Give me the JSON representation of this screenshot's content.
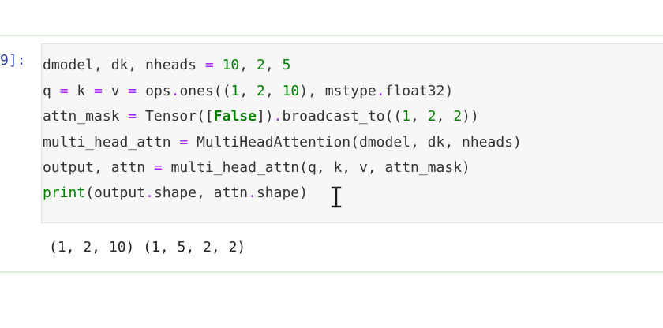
{
  "cell": {
    "prompt": "9]:",
    "code": [
      [
        {
          "t": "dmodel, dk, nheads ",
          "c": "name"
        },
        {
          "t": "=",
          "c": "op"
        },
        {
          "t": " ",
          "c": "name"
        },
        {
          "t": "10",
          "c": "num"
        },
        {
          "t": ", ",
          "c": "name"
        },
        {
          "t": "2",
          "c": "num"
        },
        {
          "t": ", ",
          "c": "name"
        },
        {
          "t": "5",
          "c": "num"
        }
      ],
      [
        {
          "t": "q ",
          "c": "name"
        },
        {
          "t": "=",
          "c": "op"
        },
        {
          "t": " k ",
          "c": "name"
        },
        {
          "t": "=",
          "c": "op"
        },
        {
          "t": " v ",
          "c": "name"
        },
        {
          "t": "=",
          "c": "op"
        },
        {
          "t": " ops",
          "c": "name"
        },
        {
          "t": ".",
          "c": "op"
        },
        {
          "t": "ones((",
          "c": "name"
        },
        {
          "t": "1",
          "c": "num"
        },
        {
          "t": ", ",
          "c": "name"
        },
        {
          "t": "2",
          "c": "num"
        },
        {
          "t": ", ",
          "c": "name"
        },
        {
          "t": "10",
          "c": "num"
        },
        {
          "t": "), mstype",
          "c": "name"
        },
        {
          "t": ".",
          "c": "op"
        },
        {
          "t": "float32)",
          "c": "name"
        }
      ],
      [
        {
          "t": "attn_mask ",
          "c": "name"
        },
        {
          "t": "=",
          "c": "op"
        },
        {
          "t": " Tensor([",
          "c": "name"
        },
        {
          "t": "False",
          "c": "kw"
        },
        {
          "t": "])",
          "c": "name"
        },
        {
          "t": ".",
          "c": "op"
        },
        {
          "t": "broadcast_to((",
          "c": "name"
        },
        {
          "t": "1",
          "c": "num"
        },
        {
          "t": ", ",
          "c": "name"
        },
        {
          "t": "2",
          "c": "num"
        },
        {
          "t": ", ",
          "c": "name"
        },
        {
          "t": "2",
          "c": "num"
        },
        {
          "t": "))",
          "c": "name"
        }
      ],
      [
        {
          "t": "multi_head_attn ",
          "c": "name"
        },
        {
          "t": "=",
          "c": "op"
        },
        {
          "t": " MultiHeadAttention(dmodel, dk, nheads)",
          "c": "name"
        }
      ],
      [
        {
          "t": "output, attn ",
          "c": "name"
        },
        {
          "t": "=",
          "c": "op"
        },
        {
          "t": " multi_head_attn(q, k, v, attn_mask)",
          "c": "name"
        }
      ],
      [
        {
          "t": "print",
          "c": "builtin"
        },
        {
          "t": "(output",
          "c": "name"
        },
        {
          "t": ".",
          "c": "op"
        },
        {
          "t": "shape, attn",
          "c": "name"
        },
        {
          "t": ".",
          "c": "op"
        },
        {
          "t": "shape)",
          "c": "name"
        }
      ]
    ],
    "output": "(1, 2, 10) (1, 5, 2, 2)"
  },
  "colors": {
    "prompt": "#303f9f",
    "operator": "#aa22ff",
    "number": "#008000",
    "keyword": "#008000",
    "cell_background": "#f7f7f7",
    "cell_border": "#dcecdc"
  },
  "icons": {
    "text_cursor": "i-beam-cursor-icon"
  }
}
